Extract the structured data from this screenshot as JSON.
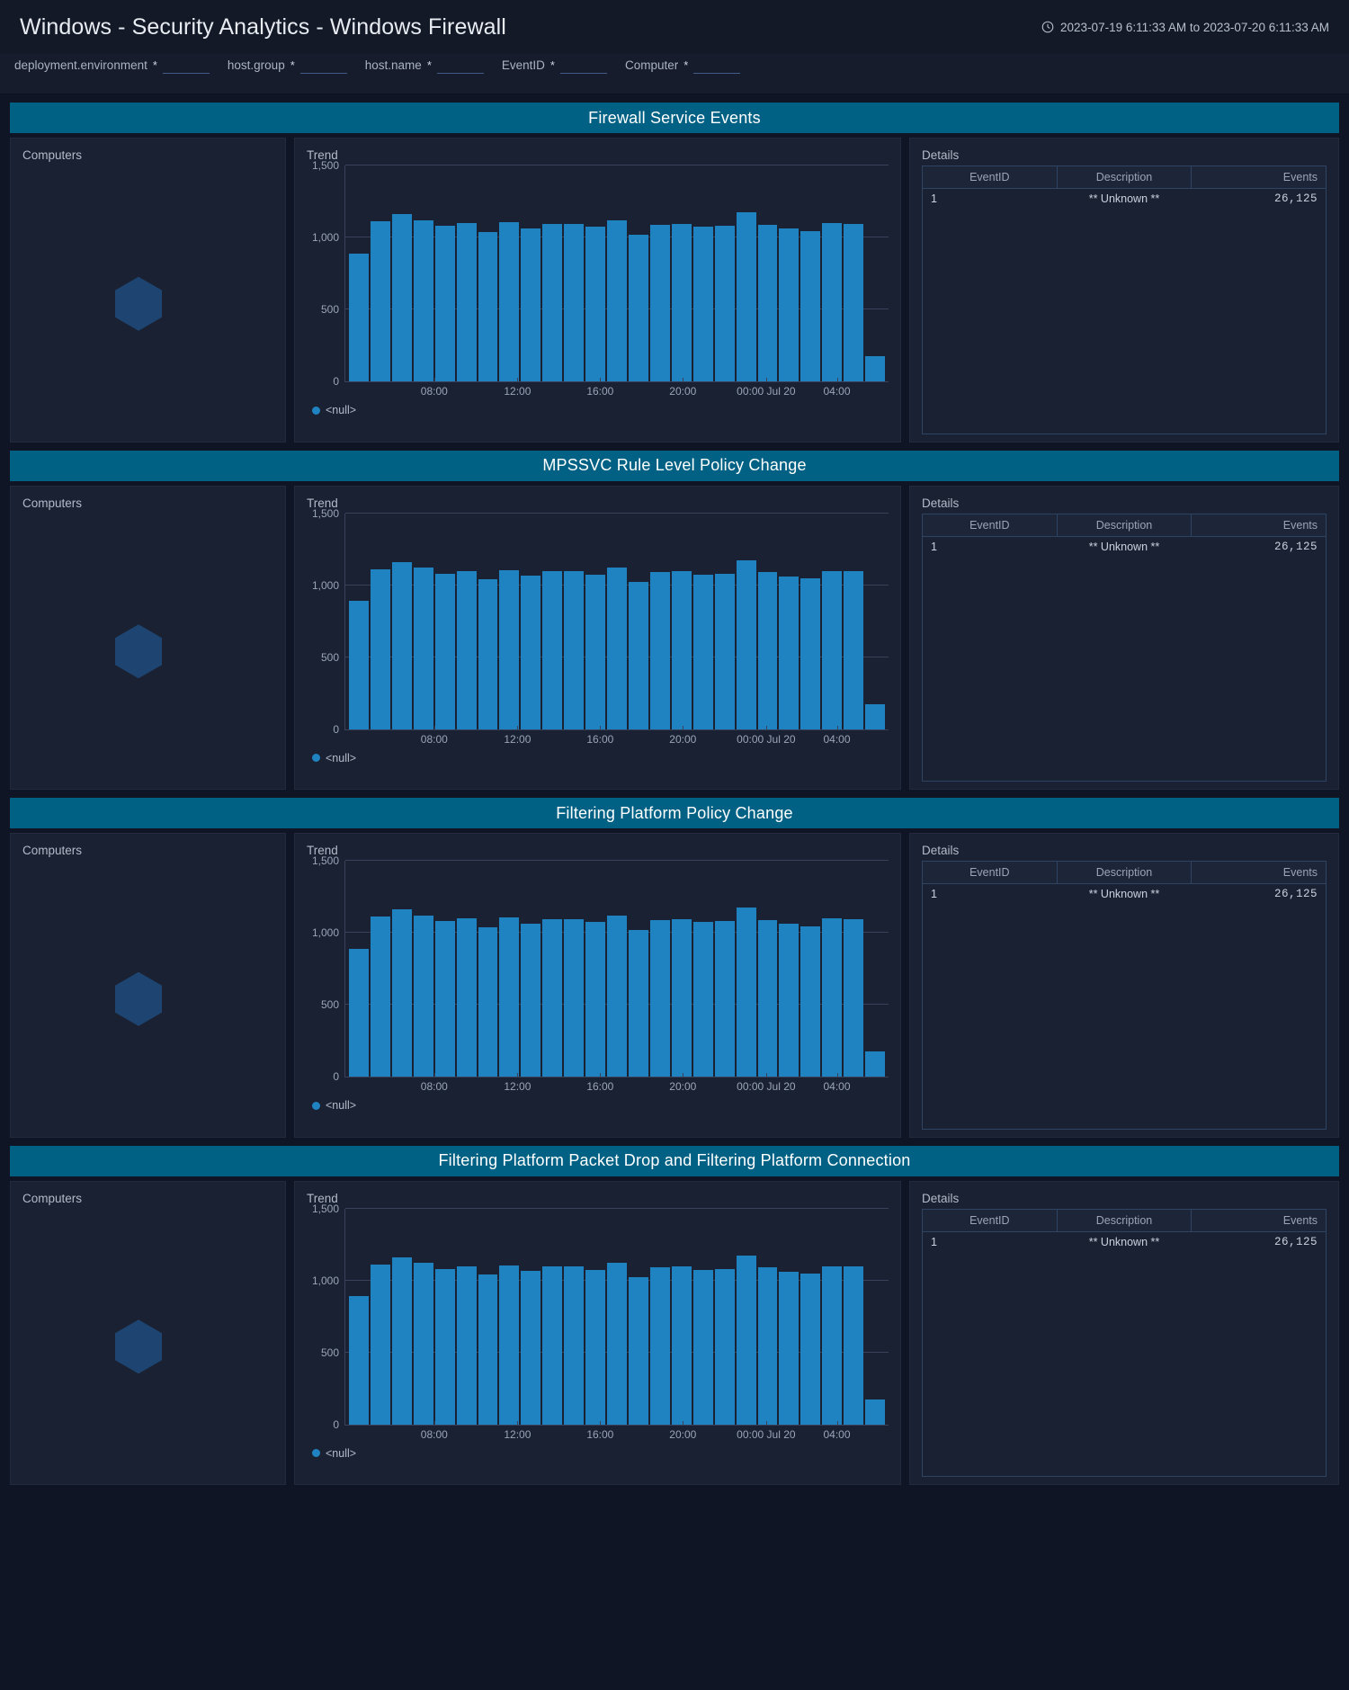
{
  "header": {
    "title": "Windows - Security Analytics - Windows Firewall",
    "time_range": "2023-07-19 6:11:33 AM to 2023-07-20 6:11:33 AM",
    "clock_icon": "clock-icon"
  },
  "filters": [
    {
      "label": "deployment.environment",
      "star": "*",
      "value": "",
      "placeholder": ""
    },
    {
      "label": "host.group",
      "star": "*",
      "value": "",
      "placeholder": ""
    },
    {
      "label": "host.name",
      "star": "*",
      "value": "",
      "placeholder": ""
    },
    {
      "label": "EventID",
      "star": "*",
      "value": "",
      "placeholder": ""
    },
    {
      "label": "Computer",
      "star": "*",
      "value": "",
      "placeholder": ""
    }
  ],
  "panel_titles": {
    "computers": "Computers",
    "trend": "Trend",
    "details": "Details"
  },
  "details_table": {
    "columns": [
      "EventID",
      "Description",
      "Events"
    ],
    "rows": [
      {
        "eventid": "1",
        "description": "** Unknown **",
        "events": "26,125"
      }
    ]
  },
  "legend": {
    "label": "<null>",
    "color": "#1f83c2"
  },
  "colors": {
    "page_bg": "#0f1525",
    "panel_bg": "#1a2132",
    "banner": "#006184",
    "bar": "#1f83c2",
    "hexagon": "#1e4571",
    "grid": "#39425a"
  },
  "sections": [
    {
      "title": "Firewall Service Events"
    },
    {
      "title": "MPSSVC Rule Level Policy Change"
    },
    {
      "title": "Filtering Platform Policy Change"
    },
    {
      "title": "Filtering Platform Packet Drop and Filtering Platform Connection"
    }
  ],
  "chart_data": {
    "type": "bar",
    "title": "Trend",
    "xlabel": "",
    "ylabel": "",
    "ylim": [
      0,
      1500
    ],
    "yticks": [
      0,
      500,
      1000,
      1500
    ],
    "ytick_labels": [
      "0",
      "500",
      "1,000",
      "1,500"
    ],
    "grid": true,
    "legend_position": "bottom-left",
    "series": [
      {
        "name": "<null>",
        "color": "#1f83c2",
        "values": [
          890,
          1110,
          1160,
          1120,
          1080,
          1100,
          1040,
          1105,
          1065,
          1095,
          1095,
          1075,
          1120,
          1020,
          1090,
          1095,
          1075,
          1080,
          1175,
          1090,
          1060,
          1045,
          1100,
          1095,
          175
        ]
      }
    ],
    "xtick_labels": [
      "08:00",
      "12:00",
      "16:00",
      "20:00",
      "00:00 Jul 20",
      "04:00"
    ],
    "xtick_positions_pct": [
      16.5,
      31.8,
      47.0,
      62.2,
      77.5,
      90.5
    ]
  }
}
